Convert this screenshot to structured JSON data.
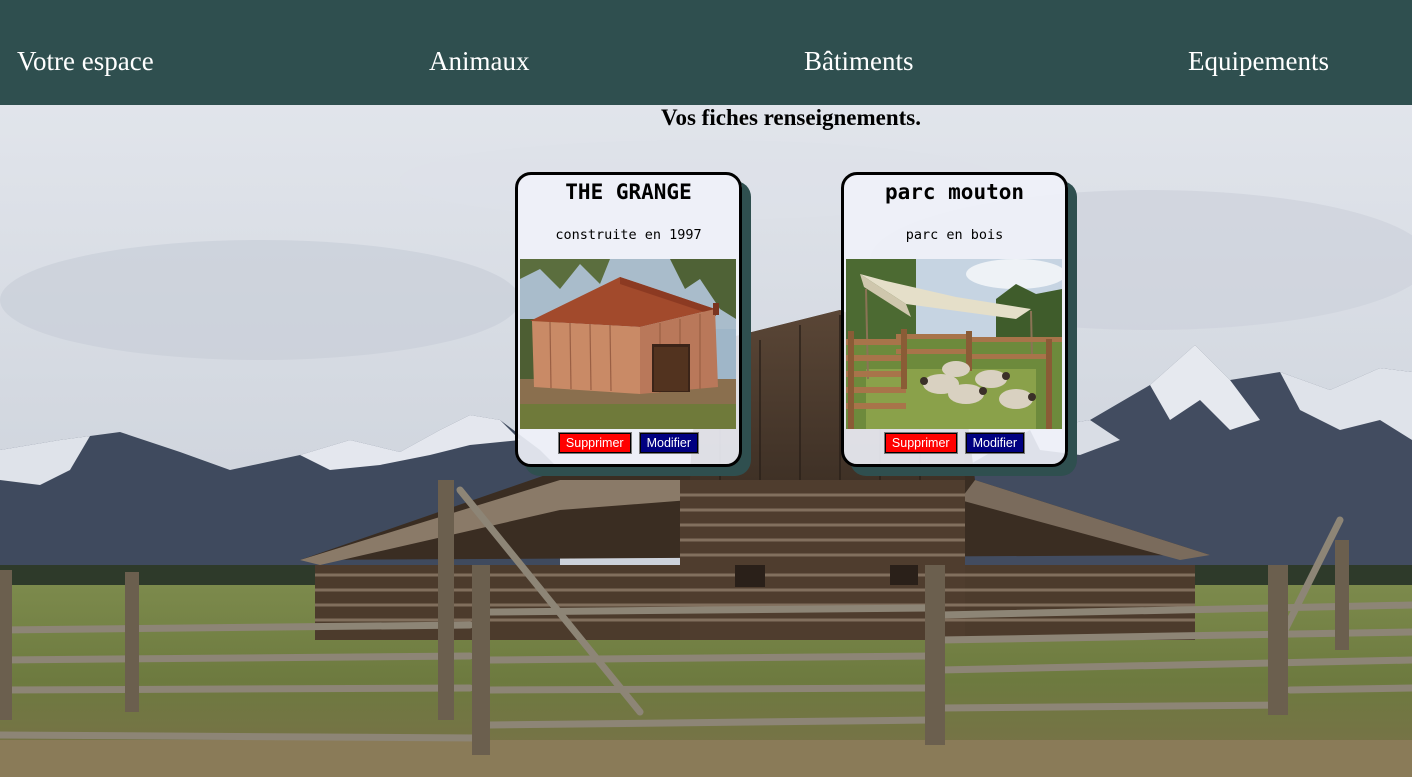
{
  "nav": {
    "items": [
      {
        "label": "Votre espace"
      },
      {
        "label": "Animaux"
      },
      {
        "label": "Bâtiments"
      },
      {
        "label": "Equipements"
      }
    ]
  },
  "page": {
    "title": "Vos fiches renseignements."
  },
  "cards": [
    {
      "title": "THE GRANGE",
      "description": "construite en 1997",
      "delete_label": "Supprimer",
      "edit_label": "Modifier"
    },
    {
      "title": "parc mouton",
      "description": "parc en bois",
      "delete_label": "Supprimer",
      "edit_label": "Modifier"
    }
  ],
  "colors": {
    "nav_background": "#2f4f4f",
    "nav_text": "#ffffff",
    "card_shadow": "#2f4f4f",
    "delete_button": "#ff0000",
    "edit_button": "#000080"
  }
}
